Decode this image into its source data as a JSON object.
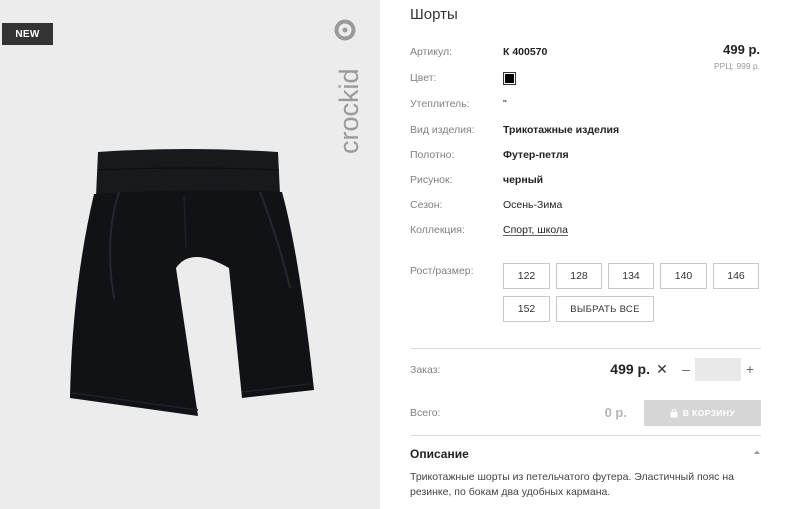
{
  "product": {
    "badge": "NEW",
    "brand": "crockid",
    "title": "Шорты",
    "price": "499 р.",
    "rrp_label": "РРЦ:",
    "rrp_value": "999 р."
  },
  "attributes": {
    "article_label": "Артикул:",
    "article_value": "К 400570",
    "color_label": "Цвет:",
    "color_swatch": "#000000",
    "insulation_label": "Утеплитель:",
    "insulation_value": "\"",
    "type_label": "Вид изделия:",
    "type_value": "Трикотажные изделия",
    "fabric_label": "Полотно:",
    "fabric_value": "Футер-петля",
    "pattern_label": "Рисунок:",
    "pattern_value": "черный",
    "season_label": "Сезон:",
    "season_value": "Осень-Зима",
    "collection_label": "Коллекция:",
    "collection_value": "Спорт, школа"
  },
  "sizes": {
    "label": "Рост/размер:",
    "options": [
      "122",
      "128",
      "134",
      "140",
      "146",
      "152"
    ],
    "select_all": "ВЫБРАТЬ ВСЕ"
  },
  "order": {
    "label": "Заказ:",
    "price": "499 р.",
    "quantity": "",
    "minus": "–",
    "plus": "+"
  },
  "total": {
    "label": "Всего:",
    "value": "0 р.",
    "cart_button": "В КОРЗИНУ"
  },
  "description": {
    "title": "Описание",
    "text": "Трикотажные шорты из петельчатого футера. Эластичный пояс на резинке, по бокам два удобных кармана."
  },
  "icons": {
    "close": "close-icon",
    "cart": "shopping-bag-icon",
    "chevron": "chevron-up-icon"
  }
}
